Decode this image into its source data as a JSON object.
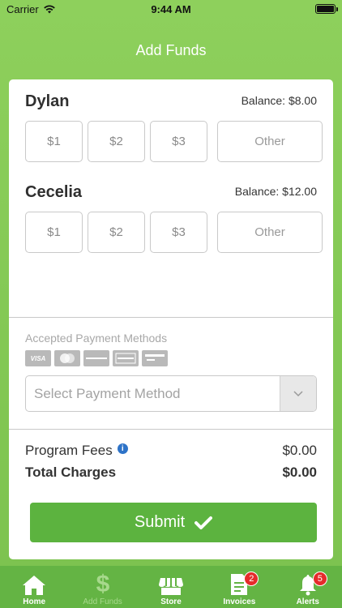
{
  "status_bar": {
    "carrier": "Carrier",
    "time": "9:44 AM"
  },
  "nav": {
    "title": "Add Funds"
  },
  "students": [
    {
      "name": "Dylan",
      "balance": "Balance: $8.00",
      "amounts": [
        "$1",
        "$2",
        "$3"
      ],
      "other_label": "Other"
    },
    {
      "name": "Cecelia",
      "balance": "Balance: $12.00",
      "amounts": [
        "$1",
        "$2",
        "$3"
      ],
      "other_label": "Other"
    }
  ],
  "payment": {
    "label": "Accepted Payment Methods",
    "card_icons": [
      "visa-icon",
      "mastercard-icon",
      "discover-icon",
      "amex-icon",
      "generic-card-icon"
    ],
    "select_placeholder": "Select Payment Method"
  },
  "fees": {
    "program_fees_label": "Program Fees",
    "program_fees_value": "$0.00",
    "total_label": "Total Charges",
    "total_value": "$0.00"
  },
  "submit_label": "Submit",
  "tabbar": {
    "tabs": [
      {
        "label": "Home",
        "icon": "home-icon"
      },
      {
        "label": "Add Funds",
        "icon": "dollar-icon"
      },
      {
        "label": "Store",
        "icon": "store-icon"
      },
      {
        "label": "Invoices",
        "icon": "invoice-icon",
        "badge": "2"
      },
      {
        "label": "Alerts",
        "icon": "bell-icon",
        "badge": "5"
      }
    ]
  },
  "colors": {
    "background": "#8ed05c",
    "submit": "#5cb33f",
    "tabbar": "#64b444",
    "badge": "#e52b2b",
    "info": "#2e73c8"
  }
}
